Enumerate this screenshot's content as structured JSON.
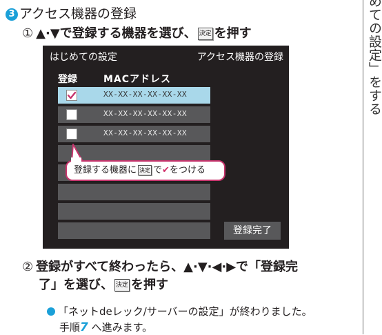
{
  "side_title": "めての設定」をする",
  "section": {
    "number": "3",
    "title": "アクセス機器の登録"
  },
  "step1": {
    "num": "①",
    "pre": "▲·▼で登録する機器を選び、",
    "key": "決定",
    "post": "を押す"
  },
  "screen": {
    "title_left": "はじめての設定",
    "title_right": "アクセス機器の登録",
    "col_register": "登録",
    "col_mac": "MACアドレス",
    "rows": [
      {
        "mac": "XX-XX-XX-XX-XX-XX",
        "checked": true
      },
      {
        "mac": "XX-XX-XX-XX-XX-XX",
        "checked": false
      },
      {
        "mac": "XX-XX-XX-XX-XX-XX",
        "checked": false
      }
    ],
    "done_button": "登録完了"
  },
  "callout": {
    "pre": "登録する機器に",
    "key": "決定",
    "mid": "で",
    "mark": "✔",
    "post": "をつける"
  },
  "step2": {
    "num": "②",
    "line1": "登録がすべて終わったら、▲·▼·◀·▶で「登録完",
    "line2_pre": "了」を選び、",
    "key": "決定",
    "line2_post": "を押す"
  },
  "note": {
    "line1": "「ネットdeレック/サーバーの設定」が終わりました。",
    "line2_pre": "手順",
    "step_no": "7",
    "line2_post": " へ進みます。"
  },
  "colors": {
    "accent": "#1ba0d8",
    "pink": "#c7356d",
    "panel": "#231f20",
    "row": "#58585a",
    "selected_row": "#a9d8ea"
  }
}
